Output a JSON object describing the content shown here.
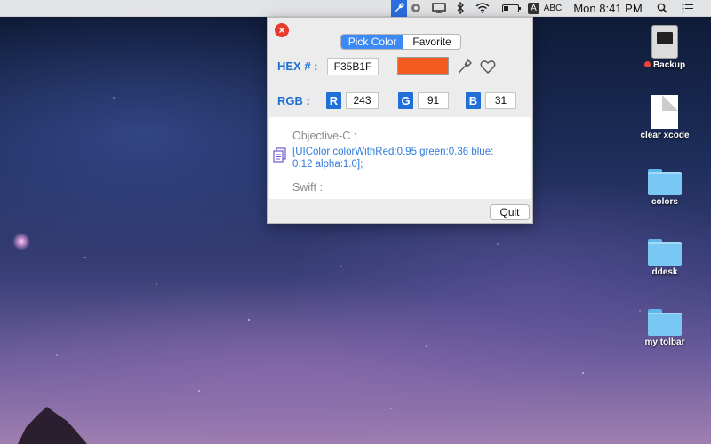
{
  "menubar": {
    "clock": "Mon 8:41 PM",
    "input_label": "ABC",
    "input_badge": "A",
    "icons": [
      "color-picker-icon",
      "colorwheel-icon",
      "display-icon",
      "bluetooth-icon",
      "wifi-icon",
      "battery-icon",
      "spotlight-icon",
      "list-icon"
    ]
  },
  "popup": {
    "tabs": [
      "Pick Color",
      "Favorite"
    ],
    "active_tab": "Pick Color",
    "hex_label": "HEX # :",
    "hex_value": "F35B1F",
    "swatch_color": "#F35B1F",
    "rgb_label": "RGB :",
    "r_label": "R",
    "r_value": "243",
    "g_label": "G",
    "g_value": "91",
    "b_label": "B",
    "b_value": "31",
    "objc_head": "Objective-C :",
    "objc_code": "[UIColor colorWithRed:0.95 green:0.36 blue: 0.12 alpha:1.0];",
    "swift_head": "Swift :",
    "quit_label": "Quit"
  },
  "desktop": {
    "items": [
      {
        "label": "Backup",
        "kind": "drive"
      },
      {
        "label": "clear xcode",
        "kind": "doc"
      },
      {
        "label": "colors",
        "kind": "folder"
      },
      {
        "label": "ddesk",
        "kind": "folder"
      },
      {
        "label": "my tolbar",
        "kind": "folder"
      }
    ]
  },
  "colors": {
    "accent": "#1f6fd6",
    "close": "#e63b2e",
    "folder": "#79c7f3"
  }
}
